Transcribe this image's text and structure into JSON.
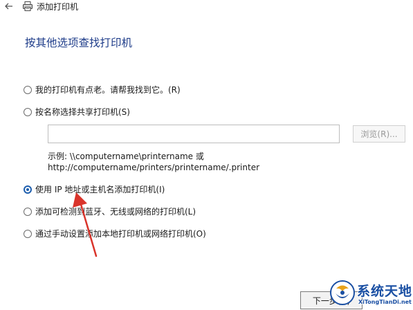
{
  "window": {
    "title": "添加打印机",
    "back_icon": "back-arrow-icon",
    "app_icon": "printer-icon"
  },
  "heading": "按其他选项查找打印机",
  "options": [
    {
      "label": "我的打印机有点老。请帮我找到它。(R)",
      "selected": false
    },
    {
      "label": "按名称选择共享打印机(S)",
      "selected": false
    },
    {
      "label": "使用 IP 地址或主机名添加打印机(I)",
      "selected": true
    },
    {
      "label": "添加可检测到蓝牙、无线或网络的打印机(L)",
      "selected": false
    },
    {
      "label": "通过手动设置添加本地打印机或网络打印机(O)",
      "selected": false
    }
  ],
  "share_input": {
    "value": "",
    "placeholder": ""
  },
  "browse_label": "浏览(R)...",
  "example": {
    "line1": "示例: \\\\computername\\printername 或",
    "line2": "http://computername/printers/printername/.printer"
  },
  "next_label": "下一步(N)",
  "colors": {
    "accent": "#1f5fae",
    "heading": "#1f3d8a",
    "annotation_arrow": "#d9342b",
    "watermark": "#1a4fa3"
  },
  "watermark": {
    "brand": "系统天地",
    "url": "XiTongTianDi.net"
  }
}
